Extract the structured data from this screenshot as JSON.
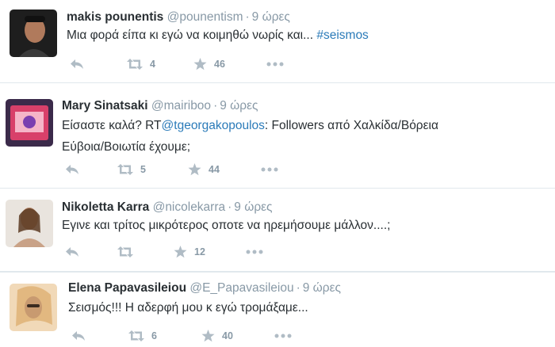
{
  "tweets": [
    {
      "name": "makis pounentis",
      "handle": "@pounentism",
      "separator": "·",
      "time": "9 ώρες",
      "text_before": "Μια φορά είπα κι εγώ να κοιμηθώ νωρίς και... ",
      "mention": "",
      "text_after": "",
      "hashtag": "#seismos",
      "retweets": "4",
      "favorites": "46",
      "avatar_colors": [
        "#1e1e1e",
        "#b07a5c"
      ]
    },
    {
      "name": "Mary Sinatsaki",
      "handle": "@mairiboo",
      "separator": "·",
      "time": "9 ώρες",
      "text_before": "Είσαστε καλά? RT",
      "mention": "@tgeorgakopoulos",
      "text_after": ": Followers από Χαλκίδα/Βόρεια Εύβοια/Βοιωτία έχουμε;",
      "hashtag": "",
      "retweets": "5",
      "favorites": "44",
      "avatar_colors": [
        "#3b2a4a",
        "#d8406a"
      ]
    },
    {
      "name": "Nikoletta Karra",
      "handle": "@nicolekarra",
      "separator": "·",
      "time": "9 ώρες",
      "text_before": "Εγινε και τρίτος μικρότερος οποτε να ηρεμήσουμε μάλλον....;",
      "mention": "",
      "text_after": "",
      "hashtag": "",
      "retweets": "",
      "favorites": "12",
      "avatar_colors": [
        "#e9e4de",
        "#b88a6c"
      ]
    },
    {
      "name": "Elena Papavasileiou",
      "handle": "@E_Papavasileiou",
      "separator": "·",
      "time": "9 ώρες",
      "text_before": "Σεισμός!!! Η αδερφή μου κ εγώ τρομάξαμε...",
      "mention": "",
      "text_after": "",
      "hashtag": "",
      "retweets": "6",
      "favorites": "40",
      "avatar_colors": [
        "#f1d9b8",
        "#c89a70"
      ]
    }
  ],
  "icons": {
    "reply": "reply-icon",
    "retweet": "retweet-icon",
    "favorite": "star-icon",
    "more": "more-icon"
  },
  "colors": {
    "name": "#292f33",
    "meta": "#8899a6",
    "link": "#2b7bb9",
    "action": "#b0bcc5",
    "divider": "#e1e8ed"
  }
}
